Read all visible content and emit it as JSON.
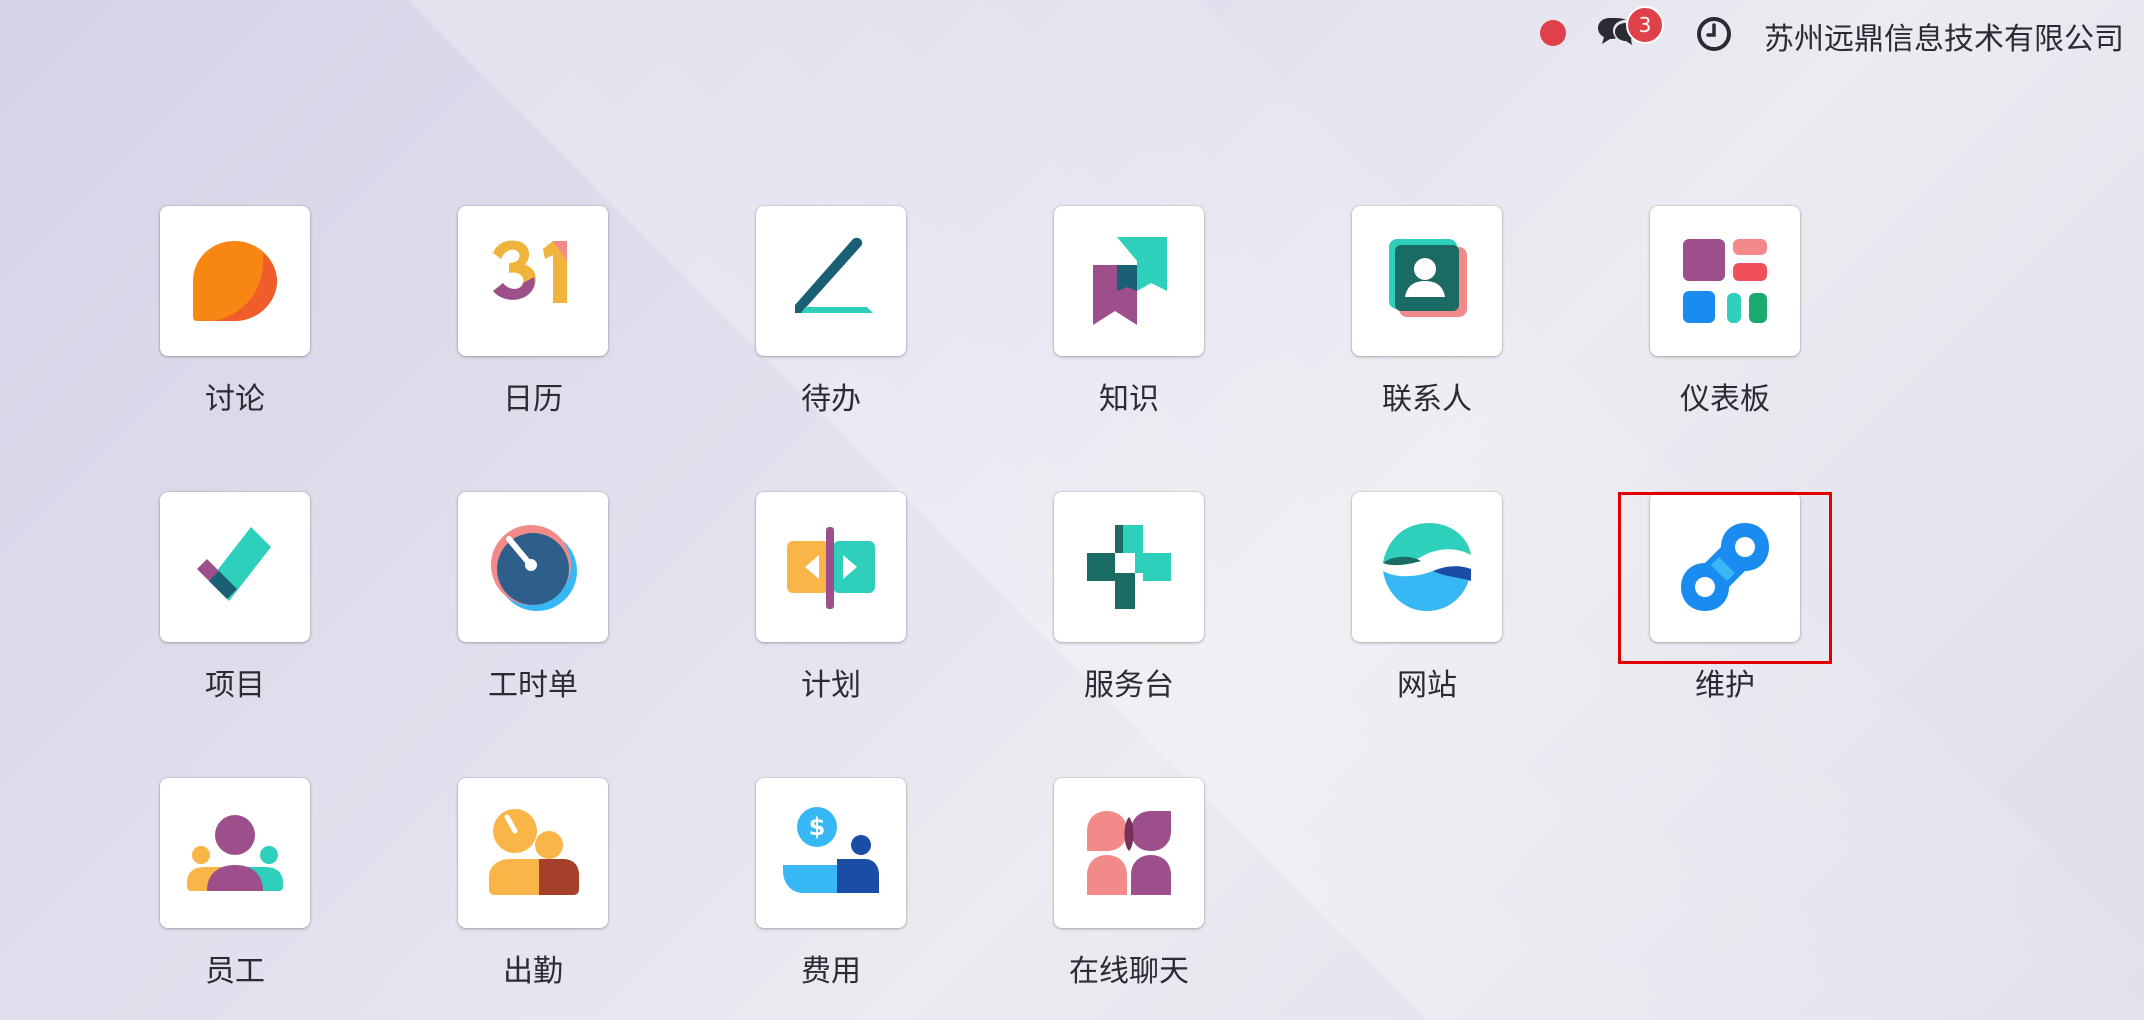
{
  "topbar": {
    "notification_count": "3",
    "company_name": "苏州远鼎信息技术有限公司"
  },
  "apps": [
    {
      "label": "讨论",
      "icon": "discuss-icon"
    },
    {
      "label": "日历",
      "icon": "calendar-icon"
    },
    {
      "label": "待办",
      "icon": "todo-icon"
    },
    {
      "label": "知识",
      "icon": "knowledge-icon"
    },
    {
      "label": "联系人",
      "icon": "contacts-icon"
    },
    {
      "label": "仪表板",
      "icon": "dashboard-icon"
    },
    {
      "label": "项目",
      "icon": "project-icon"
    },
    {
      "label": "工时单",
      "icon": "timesheet-icon"
    },
    {
      "label": "计划",
      "icon": "planning-icon"
    },
    {
      "label": "服务台",
      "icon": "helpdesk-icon"
    },
    {
      "label": "网站",
      "icon": "website-icon"
    },
    {
      "label": "维护",
      "icon": "maintenance-icon"
    },
    {
      "label": "员工",
      "icon": "employees-icon"
    },
    {
      "label": "出勤",
      "icon": "attendance-icon"
    },
    {
      "label": "费用",
      "icon": "expenses-icon"
    },
    {
      "label": "在线聊天",
      "icon": "livechat-icon"
    }
  ],
  "colors": {
    "badge": "#e0404a",
    "highlight": "#e00000"
  }
}
